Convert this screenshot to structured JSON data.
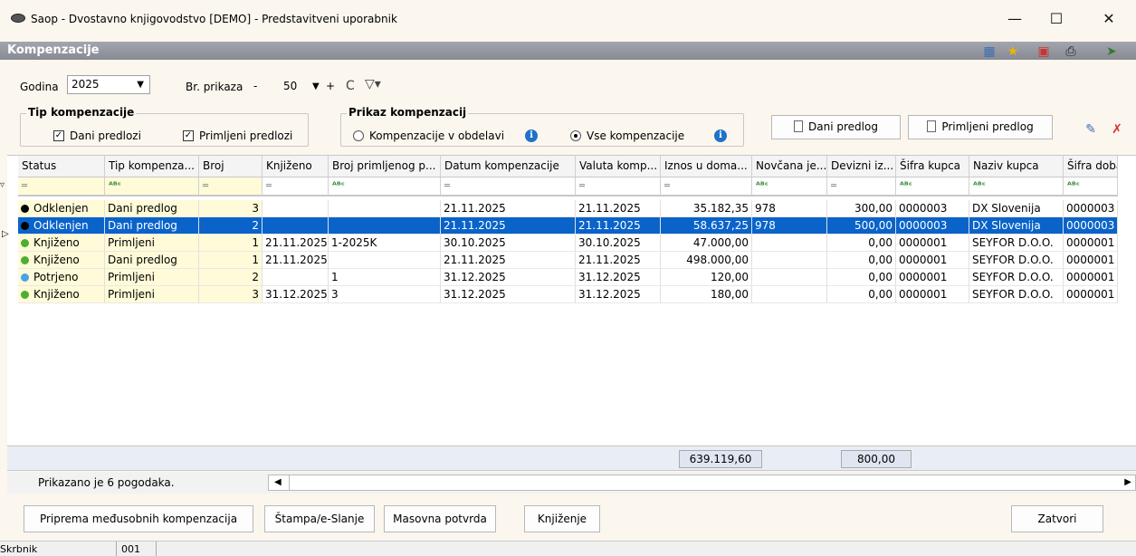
{
  "window": {
    "title": "Saop - Dvostavno knjigovodstvo [DEMO] - Predstavitveni uporabnik",
    "minimize": "—",
    "maximize": "☐",
    "close": "✕"
  },
  "header": {
    "title": "Kompenzacije",
    "icons": [
      "grid-icon",
      "star-icon",
      "pdf-icon",
      "print-icon",
      "exit-icon"
    ]
  },
  "filters": {
    "godina_label": "Godina",
    "godina_value": "2025",
    "br_prikaza_label": "Br. prikaza",
    "minus": "-",
    "br_prikaza_value": "50",
    "plus": "+",
    "refresh": "C",
    "filter": "▽▾"
  },
  "tip_kompenzacije": {
    "title": "Tip kompenzacije",
    "dani_predlozi": "Dani predlozi",
    "dani_predlozi_checked": true,
    "primljeni_predlozi": "Primljeni predlozi",
    "primljeni_predlozi_checked": true
  },
  "prikaz_kompenzacij": {
    "title": "Prikaz kompenzacij",
    "option_obdelavi": "Kompenzacije v obdelavi",
    "option_vse": "Vse kompenzacije",
    "selected": "vse"
  },
  "actions": {
    "dani_predlog": "Dani predlog",
    "primljeni_predlog": "Primljeni predlog"
  },
  "grid": {
    "columns": [
      "Status",
      "Tip kompenza...",
      "Broj",
      "Knjiženo",
      "Broj primljenog p...",
      "Datum kompenzacije",
      "Valuta komp...",
      "Iznos u doma...",
      "Novčana je...",
      "Devizni iz...",
      "Šifra kupca",
      "Naziv kupca",
      "Šifra dobav"
    ],
    "filter_types": [
      "eq",
      "abc",
      "eq",
      "eq",
      "abc",
      "eq",
      "eq",
      "eq",
      "abc",
      "eq",
      "abc",
      "abc",
      "abc"
    ],
    "rows": [
      {
        "status": "Odklenjen",
        "color": "#000000",
        "tip": "Dani predlog",
        "broj": "3",
        "knjizeno": "",
        "broj_primljenog": "",
        "datum": "21.11.2025",
        "valuta": "21.11.2025",
        "iznos": "35.182,35",
        "novcana": "978",
        "devizni": "300,00",
        "sifra_kupca": "0000003",
        "naziv_kupca": "DX Slovenija",
        "sifra_dob": "0000003",
        "selected": false
      },
      {
        "status": "Odklenjen",
        "color": "#000000",
        "tip": "Dani predlog",
        "broj": "2",
        "knjizeno": "",
        "broj_primljenog": "",
        "datum": "21.11.2025",
        "valuta": "21.11.2025",
        "iznos": "58.637,25",
        "novcana": "978",
        "devizni": "500,00",
        "sifra_kupca": "0000003",
        "naziv_kupca": "DX Slovenija",
        "sifra_dob": "0000003",
        "selected": true
      },
      {
        "status": "Knjiženo",
        "color": "#4caf2f",
        "tip": "Primljeni",
        "broj": "1",
        "knjizeno": "21.11.2025",
        "broj_primljenog": "1-2025K",
        "datum": "30.10.2025",
        "valuta": "30.10.2025",
        "iznos": "47.000,00",
        "novcana": "",
        "devizni": "0,00",
        "sifra_kupca": "0000001",
        "naziv_kupca": "SEYFOR D.O.O.",
        "sifra_dob": "0000001",
        "selected": false
      },
      {
        "status": "Knjiženo",
        "color": "#4caf2f",
        "tip": "Dani predlog",
        "broj": "1",
        "knjizeno": "21.11.2025",
        "broj_primljenog": "",
        "datum": "21.11.2025",
        "valuta": "21.11.2025",
        "iznos": "498.000,00",
        "novcana": "",
        "devizni": "0,00",
        "sifra_kupca": "0000001",
        "naziv_kupca": "SEYFOR D.O.O.",
        "sifra_dob": "0000001",
        "selected": false
      },
      {
        "status": "Potrjeno",
        "color": "#4aa3e8",
        "tip": "Primljeni",
        "broj": "2",
        "knjizeno": "",
        "broj_primljenog": "1",
        "datum": "31.12.2025",
        "valuta": "31.12.2025",
        "iznos": "120,00",
        "novcana": "",
        "devizni": "0,00",
        "sifra_kupca": "0000001",
        "naziv_kupca": "SEYFOR D.O.O.",
        "sifra_dob": "0000001",
        "selected": false
      },
      {
        "status": "Knjiženo",
        "color": "#4caf2f",
        "tip": "Primljeni",
        "broj": "3",
        "knjizeno": "31.12.2025",
        "broj_primljenog": "3",
        "datum": "31.12.2025",
        "valuta": "31.12.2025",
        "iznos": "180,00",
        "novcana": "",
        "devizni": "0,00",
        "sifra_kupca": "0000001",
        "naziv_kupca": "SEYFOR D.O.O.",
        "sifra_dob": "0000001",
        "selected": false
      }
    ],
    "totals": {
      "iznos": "639.119,60",
      "devizni": "800,00"
    }
  },
  "status": {
    "count_text": "Prikazano je 6 pogodaka."
  },
  "buttons": {
    "priprema": "Priprema međusobnih kompenzacija",
    "stampa": "Štampa/e-Slanje",
    "masovna": "Masovna potvrda",
    "knjizenje": "Knjiženje",
    "zatvori": "Zatvori"
  },
  "footer": {
    "user": "Skrbnik",
    "code": "001"
  }
}
